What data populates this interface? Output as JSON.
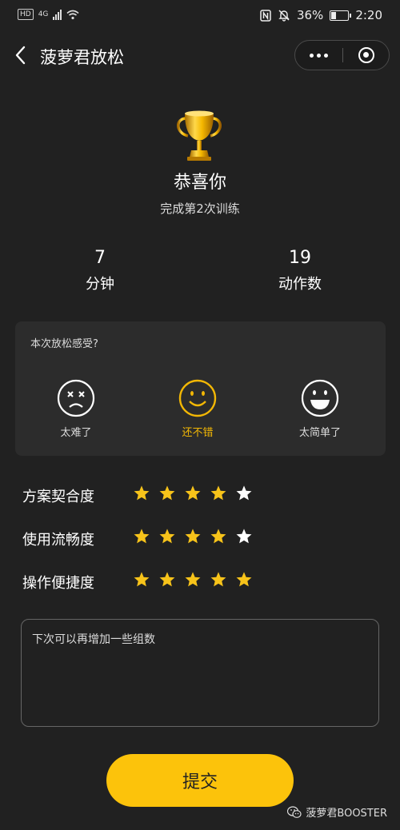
{
  "status_bar": {
    "hd": "HD",
    "network": "4G",
    "battery_percent": "36%",
    "battery_level": 0.36,
    "time": "2:20"
  },
  "nav": {
    "title": "菠萝君放松"
  },
  "result": {
    "congrats": "恭喜你",
    "subtext": "完成第2次训练"
  },
  "stats": [
    {
      "value": "7",
      "label": "分钟"
    },
    {
      "value": "19",
      "label": "动作数"
    }
  ],
  "feeling": {
    "question": "本次放松感受?",
    "options": [
      {
        "label": "太难了",
        "icon": "sad-face-icon",
        "selected": false
      },
      {
        "label": "还不错",
        "icon": "smile-face-icon",
        "selected": true
      },
      {
        "label": "太简单了",
        "icon": "laugh-face-icon",
        "selected": false
      }
    ]
  },
  "ratings": [
    {
      "label": "方案契合度",
      "score": 4,
      "max": 5
    },
    {
      "label": "使用流畅度",
      "score": 4,
      "max": 5
    },
    {
      "label": "操作便捷度",
      "score": 5,
      "max": 5
    }
  ],
  "feedback": {
    "value": "下次可以再增加一些组数"
  },
  "submit_label": "提交",
  "watermark": "菠萝君BOOSTER",
  "colors": {
    "accent": "#fcc30b",
    "star_active": "#f7c31a",
    "star_inactive": "#ffffff",
    "background": "#212121",
    "card": "#2c2c2c"
  }
}
